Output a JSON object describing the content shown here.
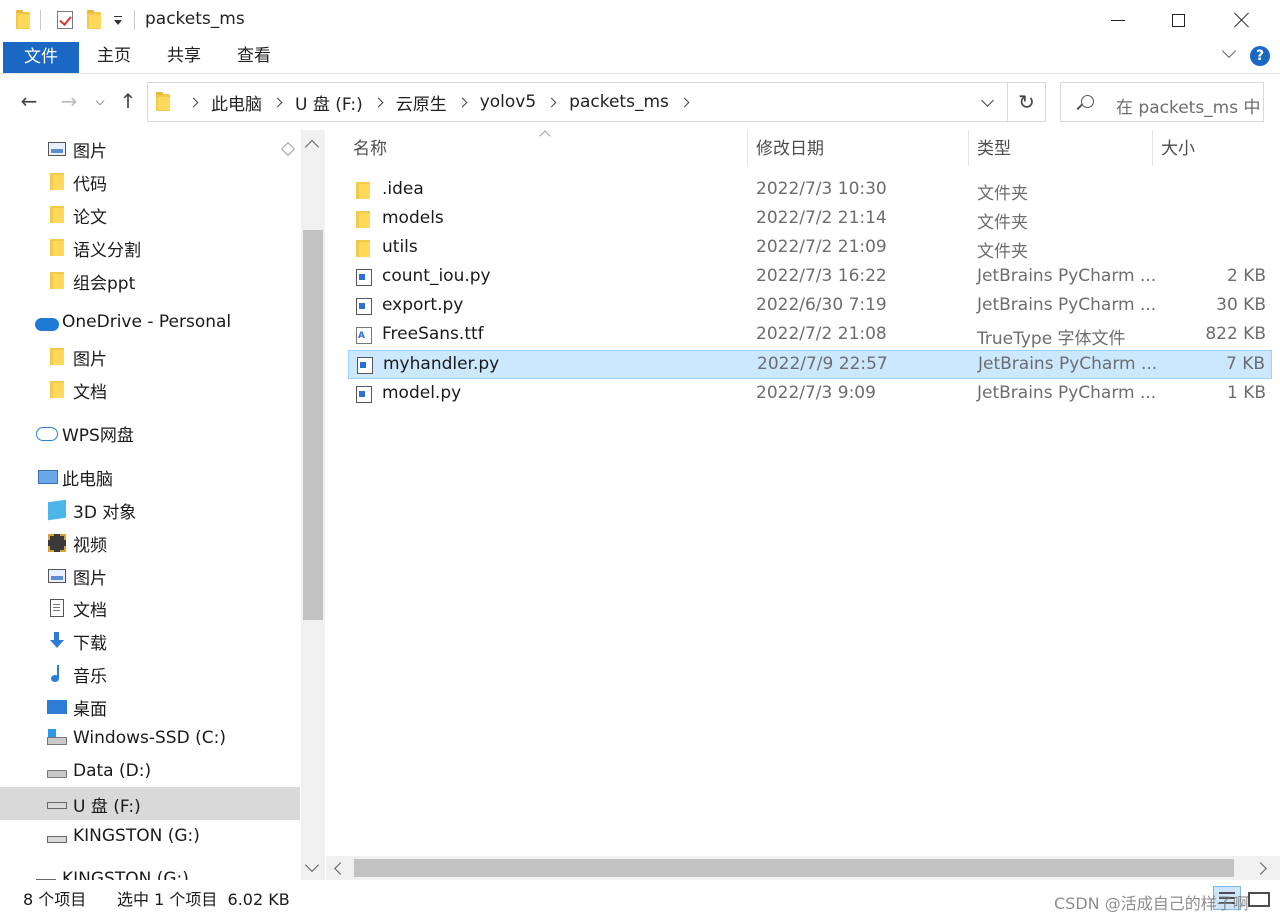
{
  "window": {
    "title": "packets_ms",
    "controls": {
      "minimize": "minimize",
      "maximize": "maximize",
      "close": "close"
    }
  },
  "ribbon": {
    "tabs": [
      {
        "label": "文件",
        "active": true
      },
      {
        "label": "主页"
      },
      {
        "label": "共享"
      },
      {
        "label": "查看"
      }
    ],
    "help": "?"
  },
  "address": {
    "breadcrumbs": [
      "此电脑",
      "U 盘 (F:)",
      "云原生",
      "yolov5",
      "packets_ms"
    ],
    "search_placeholder": "在 packets_ms 中..."
  },
  "sidebar": {
    "items": [
      {
        "label": "图片",
        "icon": "pictures-icon",
        "pinned": true
      },
      {
        "label": "代码",
        "icon": "folder-icon"
      },
      {
        "label": "论文",
        "icon": "folder-icon"
      },
      {
        "label": "语义分割",
        "icon": "folder-icon"
      },
      {
        "label": "组会ppt",
        "icon": "folder-icon"
      },
      {
        "label": "OneDrive - Personal",
        "icon": "onedrive-cloud-icon"
      },
      {
        "label": "图片",
        "icon": "folder-icon"
      },
      {
        "label": "文档",
        "icon": "folder-icon"
      },
      {
        "label": "WPS网盘",
        "icon": "wps-cloud-icon"
      },
      {
        "label": "此电脑",
        "icon": "this-pc-icon"
      },
      {
        "label": "3D 对象",
        "icon": "3d-objects-icon"
      },
      {
        "label": "视频",
        "icon": "video-icon"
      },
      {
        "label": "图片",
        "icon": "pictures-icon"
      },
      {
        "label": "文档",
        "icon": "documents-icon"
      },
      {
        "label": "下载",
        "icon": "download-icon"
      },
      {
        "label": "音乐",
        "icon": "music-icon"
      },
      {
        "label": "桌面",
        "icon": "desktop-icon"
      },
      {
        "label": "Windows-SSD (C:)",
        "icon": "windows-drive-icon"
      },
      {
        "label": "Data (D:)",
        "icon": "drive-icon"
      },
      {
        "label": "U 盘 (F:)",
        "icon": "usb-drive-icon",
        "selected": true
      },
      {
        "label": "KINGSTON (G:)",
        "icon": "usb-drive-icon"
      },
      {
        "label": "KINGSTON (G:)",
        "icon": "usb-drive-icon"
      }
    ]
  },
  "file_list": {
    "columns": [
      "名称",
      "修改日期",
      "类型",
      "大小"
    ],
    "rows": [
      {
        "name": ".idea",
        "date": "2022/7/3 10:30",
        "type": "文件夹",
        "size": "",
        "icon": "folder-icon"
      },
      {
        "name": "models",
        "date": "2022/7/2 21:14",
        "type": "文件夹",
        "size": "",
        "icon": "folder-icon"
      },
      {
        "name": "utils",
        "date": "2022/7/2 21:09",
        "type": "文件夹",
        "size": "",
        "icon": "folder-icon"
      },
      {
        "name": "count_iou.py",
        "date": "2022/7/3 16:22",
        "type": "JetBrains PyCharm ...",
        "size": "2 KB",
        "icon": "python-file-icon"
      },
      {
        "name": "export.py",
        "date": "2022/6/30 7:19",
        "type": "JetBrains PyCharm ...",
        "size": "30 KB",
        "icon": "python-file-icon"
      },
      {
        "name": "FreeSans.ttf",
        "date": "2022/7/2 21:08",
        "type": "TrueType 字体文件",
        "size": "822 KB",
        "icon": "font-file-icon"
      },
      {
        "name": "myhandler.py",
        "date": "2022/7/9 22:57",
        "type": "JetBrains PyCharm ...",
        "size": "7 KB",
        "icon": "python-file-icon",
        "selected": true
      },
      {
        "name": "model.py",
        "date": "2022/7/3 9:09",
        "type": "JetBrains PyCharm ...",
        "size": "1 KB",
        "icon": "python-file-icon"
      }
    ]
  },
  "status_bar": {
    "item_count": "8 个项目",
    "selection": "选中 1 个项目  6.02 KB"
  },
  "watermark": "CSDN @活成自己的样子啊",
  "colors": {
    "accent": "#1a68c4",
    "selection_bg": "#cce8ff",
    "selection_border": "#99d1ff",
    "nav_selected": "#d9d9d9"
  }
}
